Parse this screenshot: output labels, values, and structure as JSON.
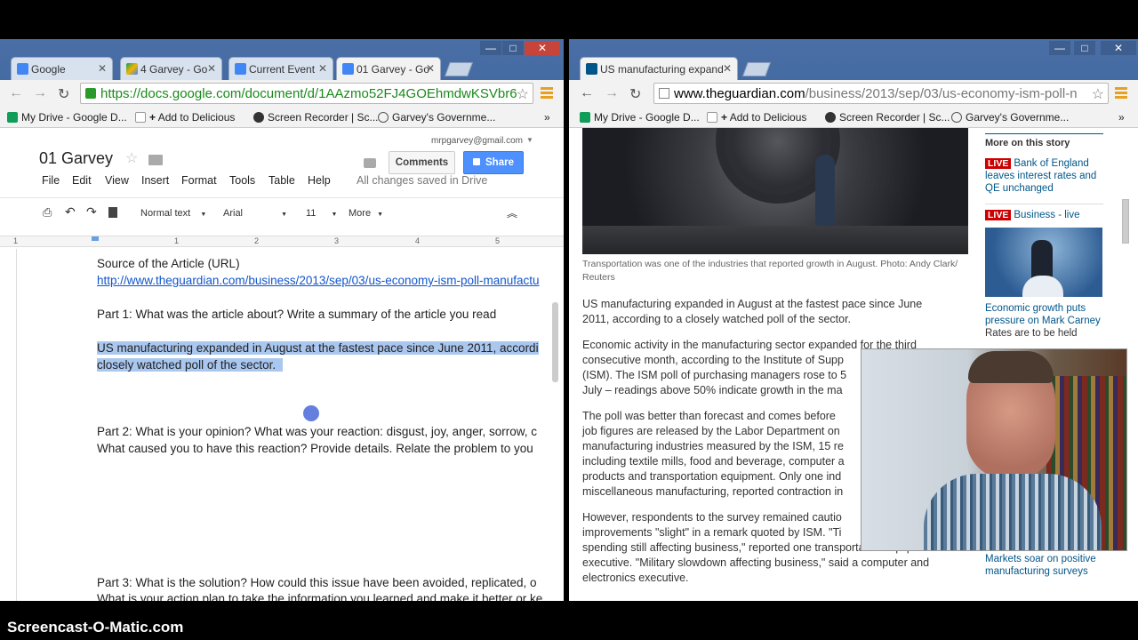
{
  "left_window": {
    "tabs": [
      {
        "label": "Google",
        "icon": "google-favicon"
      },
      {
        "label": "4 Garvey - Go",
        "icon": "drive-favicon"
      },
      {
        "label": "Current Event",
        "icon": "docs-favicon"
      },
      {
        "label": "01 Garvey - Go",
        "icon": "docs-favicon"
      }
    ],
    "window_controls": [
      "—",
      "□",
      "✕"
    ],
    "url": "https://docs.google.com/document/d/1AAzmo52FJ4GOEhmdwKSVbr6",
    "bookmarks": [
      "My Drive - Google D...",
      "Add to Delicious",
      "Screen Recorder | Sc...",
      "Garvey's Governme..."
    ],
    "bookmarks_more": "»",
    "user_email": "mrpgarvey@gmail.com",
    "doc_title": "01 Garvey",
    "menu": [
      "File",
      "Edit",
      "View",
      "Insert",
      "Format",
      "Tools",
      "Table",
      "Help"
    ],
    "save_status": "All changes saved in Drive",
    "comments_label": "Comments",
    "share_label": "Share",
    "style_select": "Normal text",
    "font_select": "Arial",
    "size_select": "11",
    "more_label": "More",
    "ruler_marks": [
      "1",
      "1",
      "2",
      "3",
      "4",
      "5"
    ],
    "doc_lines": {
      "source_label": "Source of the Article (URL)",
      "source_url": "http://www.theguardian.com/business/2013/sep/03/us-economy-ism-poll-manufactu",
      "part1": "Part 1: What was the article about? Write a summary of the article you read",
      "summary_1": "US manufacturing expanded in August at the fastest pace since June 2011, accordi",
      "summary_2": "closely watched poll of the sector.",
      "part2_1": "Part 2: What is your opinion?  What was your reaction: disgust, joy, anger, sorrow, c",
      "part2_2": "What caused you to have this reaction?  Provide details.  Relate the problem to you",
      "part3_1": "Part 3: What is the solution?  How could this issue have been avoided, replicated, o",
      "part3_2": "What is your action plan to take the information you learned and make it better or ke"
    }
  },
  "right_window": {
    "tab_label": "US manufacturing expand",
    "window_controls": [
      "—",
      "□",
      "✕"
    ],
    "url_prefix": "www.theguardian.com",
    "url_rest": "/business/2013/sep/03/us-economy-ism-poll-n",
    "bookmarks": [
      "My Drive - Google D...",
      "Add to Delicious",
      "Screen Recorder | Sc...",
      "Garvey's Governme..."
    ],
    "bookmarks_more": "»",
    "caption": "Transportation was one of the industries that reported growth in August. Photo: Andy Clark/ Reuters",
    "paragraphs": [
      [
        "US manufacturing expanded in August at the fastest pace since June",
        "2011, according to a closely watched poll of the sector."
      ],
      [
        "Economic activity in the manufacturing sector expanded for the third",
        "consecutive month, according to the Institute of Supp",
        "(ISM). The ISM poll of purchasing managers rose to 5",
        "July – readings above 50% indicate growth in the ma"
      ],
      [
        "The poll was better than forecast and comes before",
        "job figures are released by the Labor Department on",
        "manufacturing industries measured by the ISM, 15 re",
        "including textile mills, food and beverage, computer a",
        "products and transportation equipment. Only one ind",
        "miscellaneous manufacturing, reported contraction in"
      ],
      [
        "However, respondents to the survey remained cautio",
        "improvements \"slight\" in a remark quoted by ISM. \"Ti",
        "spending still affecting business,\" reported one transportation equipment",
        "executive. \"Military slowdown affecting business,\" said a computer and",
        "electronics executive."
      ]
    ],
    "sidebar": {
      "heading": "More on this story",
      "items": [
        {
          "badge": "LIVE",
          "text": "Bank of England leaves interest rates and QE unchanged"
        },
        {
          "badge": "LIVE",
          "text": "Business - live"
        }
      ],
      "story2_title": "Economic growth puts pressure on Mark Carney",
      "story2_sub": "Rates are to be held",
      "story3_title": "Markets soar on positive manufacturing surveys"
    }
  },
  "watermark": "Screencast-O-Matic.com"
}
